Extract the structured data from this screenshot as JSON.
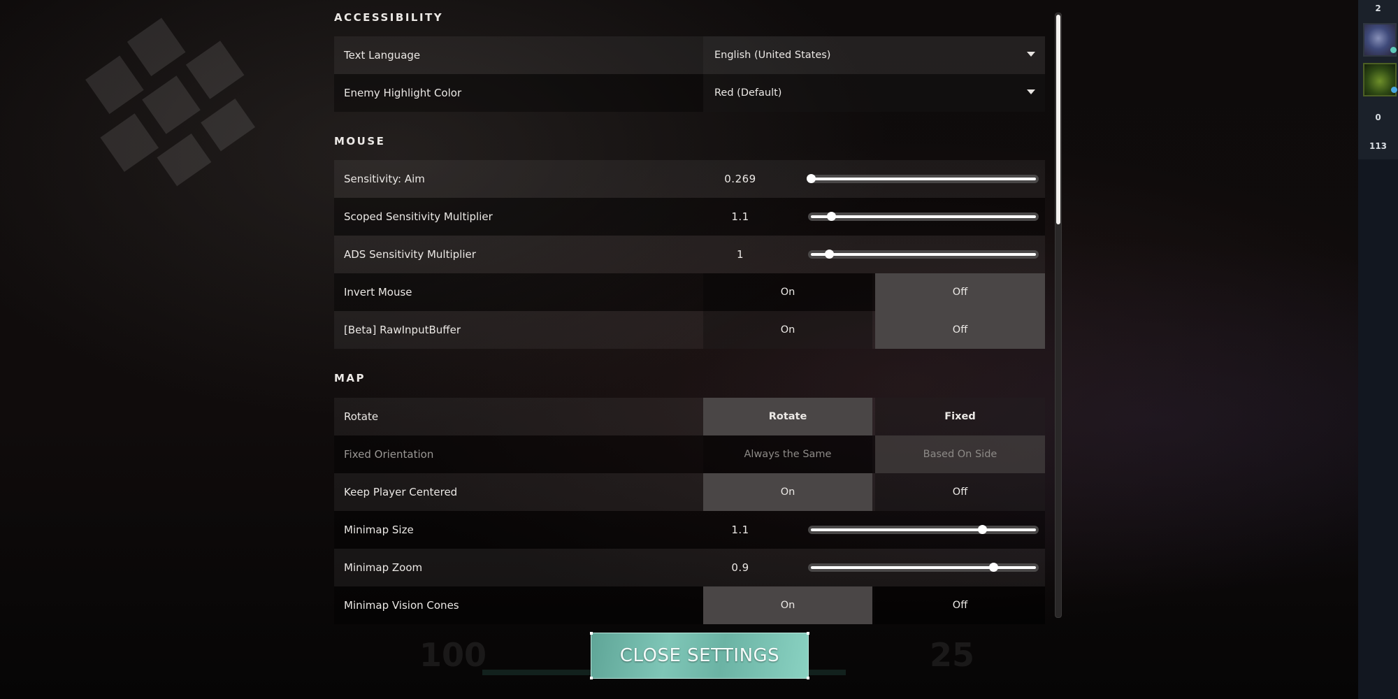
{
  "sections": {
    "accessibility": {
      "title": "ACCESSIBILITY",
      "rows": [
        {
          "label": "Text Language",
          "type": "dropdown",
          "value": "English (United States)"
        },
        {
          "label": "Enemy Highlight Color",
          "type": "dropdown",
          "value": "Red (Default)"
        }
      ]
    },
    "mouse": {
      "title": "MOUSE",
      "rows": [
        {
          "label": "Sensitivity: Aim",
          "type": "slider",
          "value": "0.269",
          "fraction": 0.0
        },
        {
          "label": "Scoped Sensitivity Multiplier",
          "type": "slider",
          "value": "1.1",
          "fraction": 0.09
        },
        {
          "label": "ADS Sensitivity Multiplier",
          "type": "slider",
          "value": "1",
          "fraction": 0.08
        },
        {
          "label": "Invert Mouse",
          "type": "toggle",
          "options": [
            "On",
            "Off"
          ],
          "selected": "Off"
        },
        {
          "label": "[Beta] RawInputBuffer",
          "type": "toggle",
          "options": [
            "On",
            "Off"
          ],
          "selected": "Off"
        }
      ]
    },
    "map": {
      "title": "MAP",
      "rows": [
        {
          "label": "Rotate",
          "type": "toggle",
          "options": [
            "Rotate",
            "Fixed"
          ],
          "selected": "Rotate"
        },
        {
          "label": "Fixed Orientation",
          "type": "toggle",
          "options": [
            "Always the Same",
            "Based On Side"
          ],
          "selected": "Based On Side",
          "disabled": true
        },
        {
          "label": "Keep Player Centered",
          "type": "toggle",
          "options": [
            "On",
            "Off"
          ],
          "selected": "On"
        },
        {
          "label": "Minimap Size",
          "type": "slider",
          "value": "1.1",
          "fraction": 0.76
        },
        {
          "label": "Minimap Zoom",
          "type": "slider",
          "value": "0.9",
          "fraction": 0.81
        },
        {
          "label": "Minimap Vision Cones",
          "type": "toggle",
          "options": [
            "On",
            "Off"
          ],
          "selected": "On"
        }
      ]
    }
  },
  "close_button": {
    "label": "CLOSE SETTINGS"
  },
  "scroll": {
    "position_fraction": 0.0
  },
  "side_panel": {
    "top_count": "2",
    "agents": [
      {
        "icon": "agent-portrait-1-icon",
        "status_color": "#5ec8b8"
      },
      {
        "icon": "agent-portrait-2-icon",
        "status_color": "#4aa8e0"
      }
    ],
    "count_a": "0",
    "count_b": "113"
  },
  "colors": {
    "accent": "#7fc6b7",
    "toggle_active": "#4a4646"
  }
}
